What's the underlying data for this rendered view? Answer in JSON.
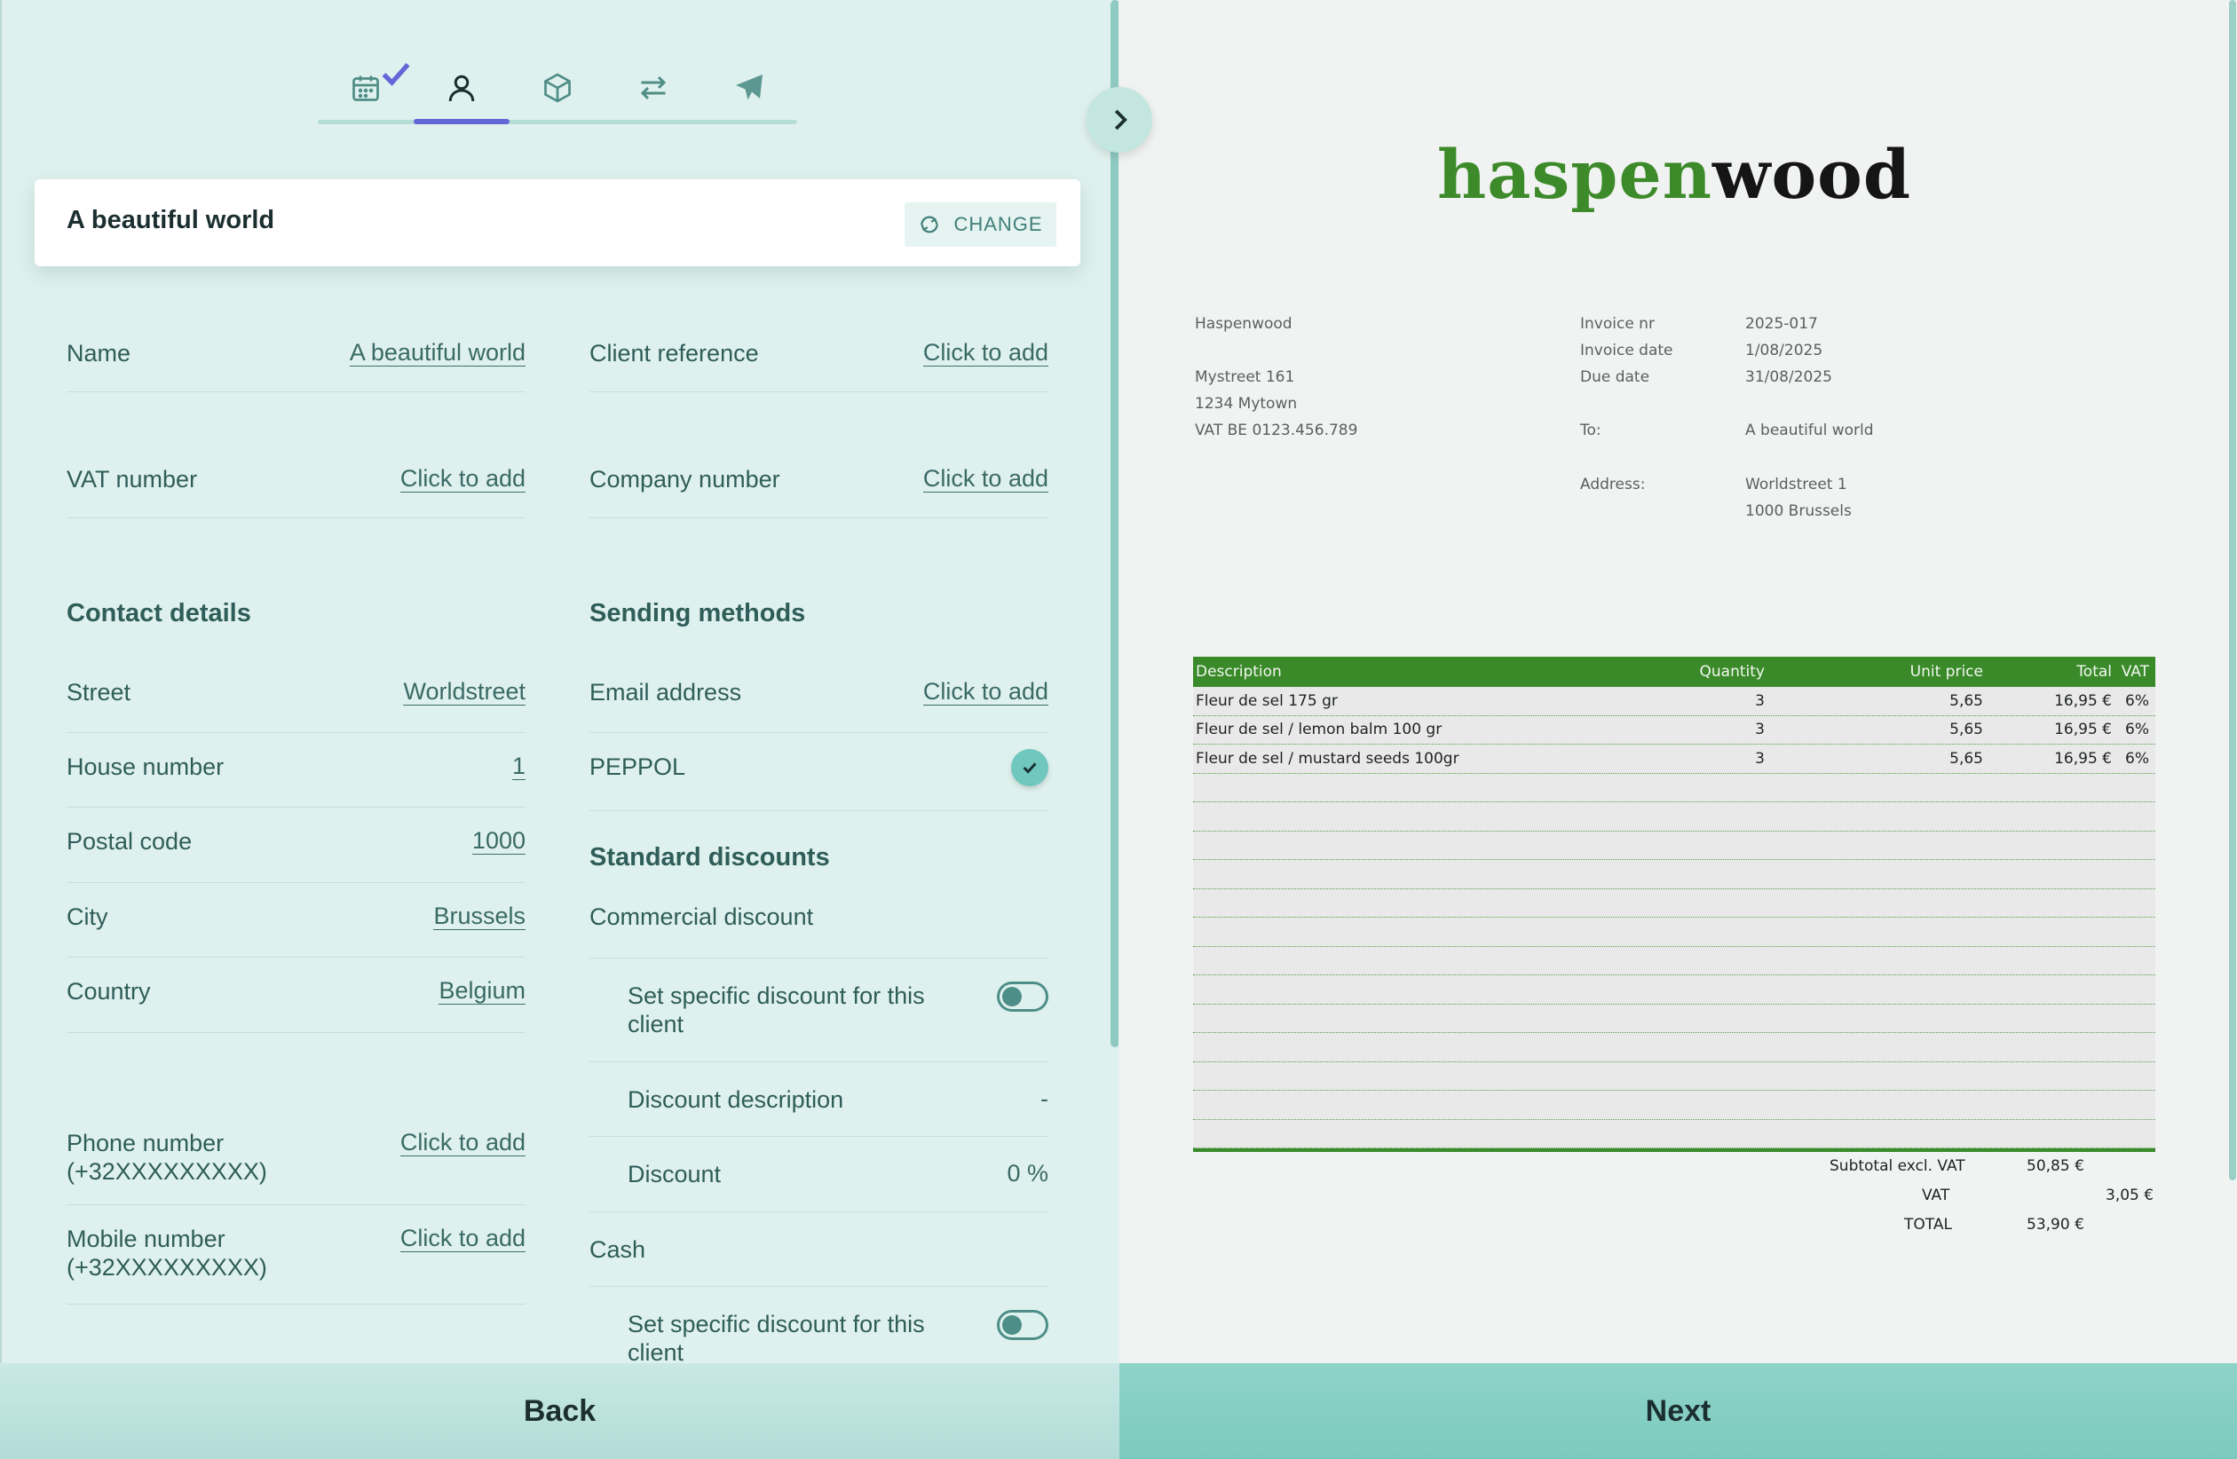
{
  "tabs": [
    {
      "name": "calendar-icon",
      "completed": true
    },
    {
      "name": "user-icon",
      "active": true
    },
    {
      "name": "box-icon"
    },
    {
      "name": "transfer-icon"
    },
    {
      "name": "send-icon"
    }
  ],
  "client_card": {
    "title": "A beautiful world",
    "change_label": "CHANGE"
  },
  "fields_left": [
    {
      "label": "Name",
      "value": "A beautiful world"
    },
    {
      "label": "VAT number",
      "value": "Click to add"
    }
  ],
  "fields_right": [
    {
      "label": "Client reference",
      "value": "Click to add"
    },
    {
      "label": "Company number",
      "value": "Click to add"
    }
  ],
  "contact": {
    "title": "Contact details",
    "street": {
      "label": "Street",
      "value": "Worldstreet"
    },
    "house_number": {
      "label": "House number",
      "value": "1"
    },
    "postal_code": {
      "label": "Postal code",
      "value": "1000"
    },
    "city": {
      "label": "City",
      "value": "Brussels"
    },
    "country": {
      "label": "Country",
      "value": "Belgium"
    },
    "phone": {
      "label": "Phone number (+32XXXXXXXXX)",
      "value": "Click to add"
    },
    "mobile": {
      "label": "Mobile number (+32XXXXXXXXX)",
      "value": "Click to add"
    }
  },
  "sending": {
    "title": "Sending methods",
    "email": {
      "label": "Email address",
      "value": "Click to add"
    },
    "peppol": {
      "label": "PEPPOL",
      "checked": true
    }
  },
  "discounts": {
    "title": "Standard discounts",
    "commercial": "Commercial discount",
    "specific_label": "Set specific discount for this client",
    "description": {
      "label": "Discount description",
      "value": "-"
    },
    "discount": {
      "label": "Discount",
      "value": "0 %"
    },
    "cash": "Cash",
    "cash_specific_label": "Set specific discount for this client"
  },
  "invoice": {
    "logo_green": "haspen",
    "logo_black": "wood",
    "company": "Haspenwood",
    "address1": "Mystreet 161",
    "address2": "1234 Mytown",
    "vat": "VAT BE 0123.456.789",
    "invoice_nr_label": "Invoice nr",
    "invoice_nr": "2025-017",
    "invoice_date_label": "Invoice date",
    "invoice_date": "1/08/2025",
    "due_date_label": "Due date",
    "due_date": "31/08/2025",
    "to_label": "To:",
    "to": "A beautiful world",
    "address_label": "Address:",
    "client_address1": "Worldstreet 1",
    "client_address2": "1000 Brussels",
    "headers": {
      "description": "Description",
      "quantity": "Quantity",
      "unit_price": "Unit price",
      "total": "Total",
      "vat": "VAT"
    },
    "lines": [
      {
        "description": "Fleur de sel 175 gr",
        "quantity": "3",
        "unit_price": "5,65",
        "total": "16,95 €",
        "vat": "6%"
      },
      {
        "description": "Fleur de sel / lemon balm 100 gr",
        "quantity": "3",
        "unit_price": "5,65",
        "total": "16,95 €",
        "vat": "6%"
      },
      {
        "description": "Fleur de sel / mustard seeds 100gr",
        "quantity": "3",
        "unit_price": "5,65",
        "total": "16,95 €",
        "vat": "6%"
      }
    ],
    "subtotal_label": "Subtotal excl. VAT",
    "subtotal": "50,85 €",
    "vat_label": "VAT",
    "vat_total": "3,05 €",
    "total_label": "TOTAL",
    "total": "53,90 €"
  },
  "footer": {
    "back": "Back",
    "next": "Next"
  },
  "colors": {
    "accent": "#6366d6",
    "brand_green": "#3a8a2a",
    "teal": "#7ccabe"
  }
}
